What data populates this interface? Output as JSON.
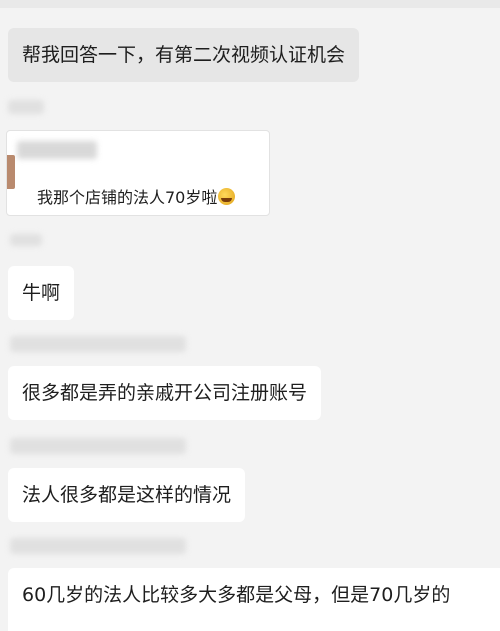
{
  "messages": [
    {
      "text": "帮我回答一下，有第二次视频认证机会"
    },
    {
      "quote_text": "我那个店铺的法人70岁啦"
    },
    {
      "text": "牛啊"
    },
    {
      "text": "很多都是弄的亲戚开公司注册账号"
    },
    {
      "text": "法人很多都是这样的情况"
    },
    {
      "text": "60几岁的法人比较多大多都是父母，但是70几岁的"
    }
  ],
  "emoji_name": "laughing-crying-emoji"
}
